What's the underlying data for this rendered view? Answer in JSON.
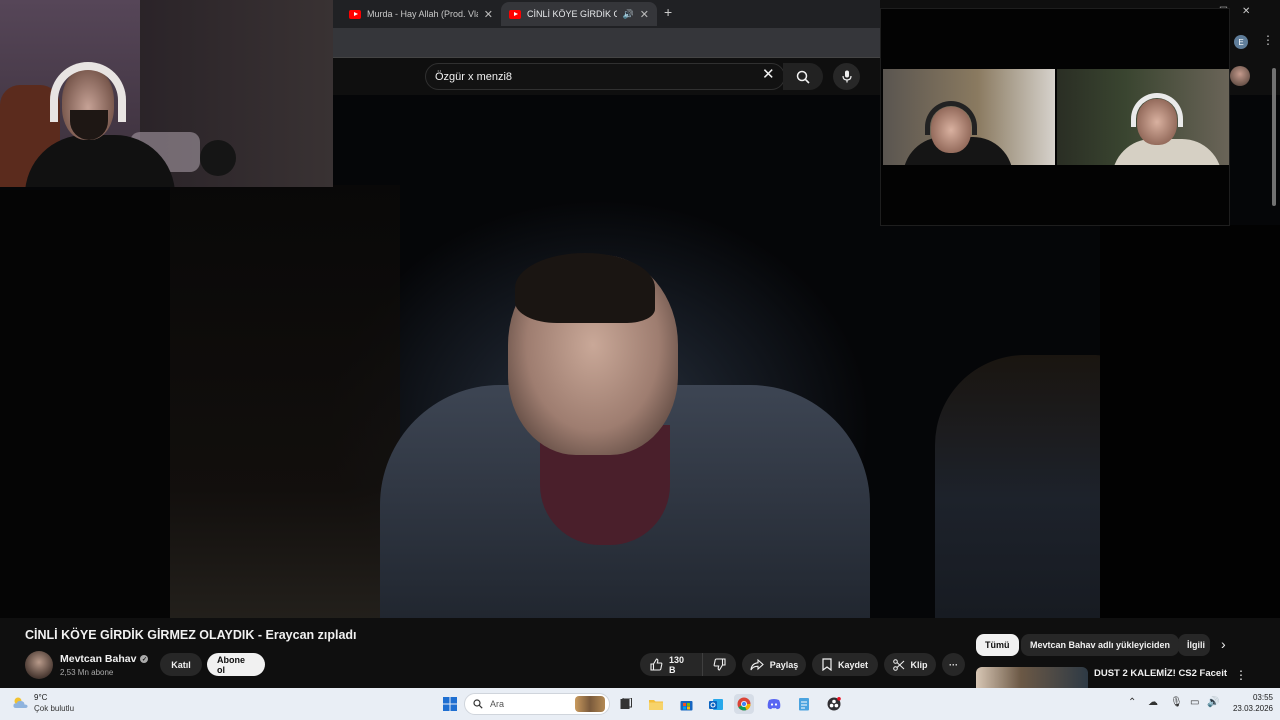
{
  "browser": {
    "tabs": [
      {
        "title": "Murda - Hay Allah (Prod. Vlado",
        "close": "✕"
      },
      {
        "title": "CİNLİ KÖYE GİRDİK GİRMEZ",
        "close": "✕"
      }
    ],
    "new_tab": "+",
    "window_controls": [
      "—",
      "☐",
      "✕"
    ],
    "profile_initial": "E"
  },
  "youtube": {
    "search": {
      "value": "Özgür x menzi8"
    },
    "video": {
      "title": "CİNLİ KÖYE GİRDİK GİRMEZ OLAYDIK - Eraycan zıpladı",
      "channel": "Mevtcan Bahav",
      "subscribers": "2,53 Mn abone",
      "join_label": "Katıl",
      "subscribe_label": "Abone ol",
      "likes": "130 B",
      "share_label": "Paylaş",
      "save_label": "Kaydet",
      "clip_label": "Klip",
      "more_label": "···"
    },
    "chips": [
      {
        "label": "Tümü",
        "active": true
      },
      {
        "label": "Mevtcan Bahav adlı yükleyiciden",
        "active": false
      },
      {
        "label": "İlgili",
        "active": false
      }
    ],
    "recommendation": {
      "title": "DUST 2 KALEMİZ! CS2 Faceit"
    }
  },
  "taskbar": {
    "weather_temp": "9°C",
    "weather_desc": "Çok bulutlu",
    "search_placeholder": "Ara",
    "time": "03:55",
    "date": "23.03.2026"
  },
  "colors": {
    "youtube_red": "#ff0000",
    "bg": "#0f0f0f",
    "chip_bg": "#272727",
    "taskbar_bg": "#e9eef5"
  }
}
